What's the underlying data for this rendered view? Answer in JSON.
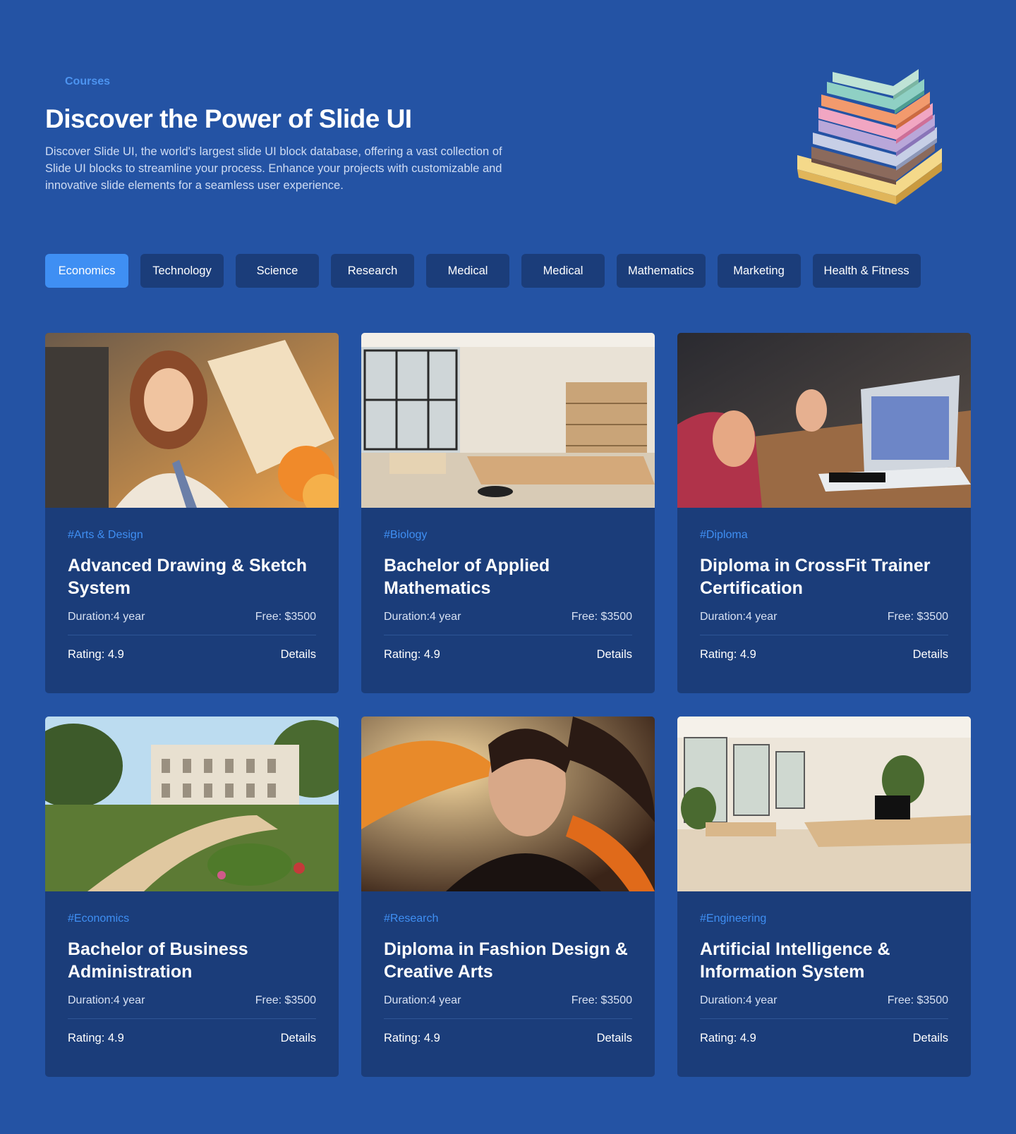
{
  "header": {
    "eyebrow": "Courses",
    "title": "Discover the Power of Slide UI",
    "description": "Discover Slide UI, the world's largest slide UI block database, offering a vast collection of Slide UI blocks to streamline your process. Enhance your projects with customizable and innovative slide elements for a seamless user experience."
  },
  "tabs": [
    {
      "label": "Economics",
      "active": true
    },
    {
      "label": "Technology"
    },
    {
      "label": "Science"
    },
    {
      "label": "Research"
    },
    {
      "label": "Medical"
    },
    {
      "label": "Medical"
    },
    {
      "label": "Mathematics"
    },
    {
      "label": "Marketing"
    },
    {
      "label": "Health & Fitness"
    }
  ],
  "courses": [
    {
      "tag": "#Arts & Design",
      "title": "Advanced Drawing & Sketch System",
      "duration": "Duration:4 year",
      "fee": "Free: $3500",
      "rating": "Rating: 4.9",
      "details": "Details",
      "image": "woman-painting-photo"
    },
    {
      "tag": "#Biology",
      "title": "Bachelor of Applied Mathematics",
      "duration": "Duration:4 year",
      "fee": "Free: $3500",
      "rating": "Rating: 4.9",
      "details": "Details",
      "image": "office-interior-photo"
    },
    {
      "tag": "#Diploma",
      "title": "Diploma in CrossFit  Trainer Certification",
      "duration": "Duration:4 year",
      "fee": "Free: $3500",
      "rating": "Rating: 4.9",
      "details": "Details",
      "image": "laptop-meeting-photo"
    },
    {
      "tag": "#Economics",
      "title": "Bachelor of Business Administration",
      "duration": "Duration:4 year",
      "fee": "Free: $3500",
      "rating": "Rating: 4.9",
      "details": "Details",
      "image": "campus-garden-photo"
    },
    {
      "tag": "#Research",
      "title": "Diploma in Fashion Design & Creative Arts",
      "duration": "Duration:4 year",
      "fee": "Free: $3500",
      "rating": "Rating: 4.9",
      "details": "Details",
      "image": "fashion-portrait-photo"
    },
    {
      "tag": "#Engineering",
      "title": "Artificial Intelligence & Information System",
      "duration": "Duration:4 year",
      "fee": "Free: $3500",
      "rating": "Rating: 4.9",
      "details": "Details",
      "image": "open-office-photo"
    }
  ],
  "colors": {
    "background": "#2453a4",
    "card": "#1b3d7a",
    "accent": "#3f8ff3"
  }
}
